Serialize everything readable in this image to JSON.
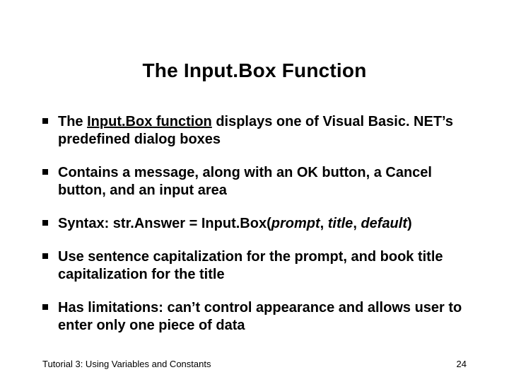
{
  "title": "The Input.Box Function",
  "bullets": {
    "b1": {
      "pre": "The ",
      "u": "Input.Box function",
      "post": " displays one of Visual Basic. NET’s predefined dialog boxes"
    },
    "b2": "Contains a message, along with an OK button, a Cancel button, and an input area",
    "b3": {
      "pre": "Syntax: str.Answer = Input.Box(",
      "args": "prompt",
      "sep1": ", ",
      "arg2": "title",
      "sep2": ", ",
      "arg3": "default",
      "post": ")"
    },
    "b4": "Use sentence capitalization for the prompt, and book title capitalization for the title",
    "b5": "Has limitations: can’t control appearance and allows user to enter only one piece of data"
  },
  "footer": {
    "left": "Tutorial 3: Using Variables and Constants",
    "right": "24"
  }
}
